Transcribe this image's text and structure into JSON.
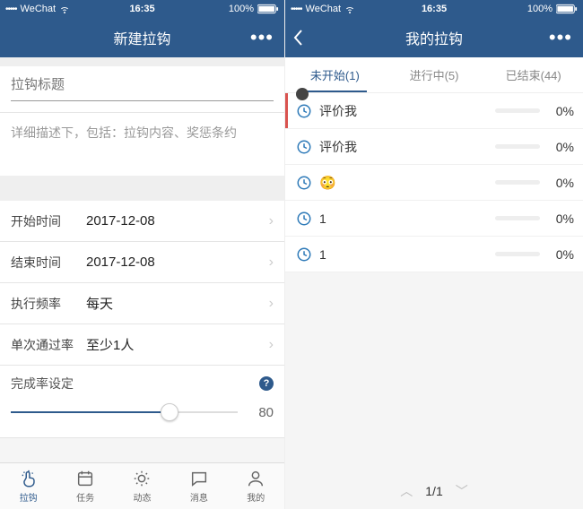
{
  "status": {
    "carrier": "WeChat",
    "signal": "•••••",
    "time": "16:35",
    "battery_pct": "100%"
  },
  "left": {
    "nav_title": "新建拉钩",
    "title_placeholder": "拉钩标题",
    "desc_placeholder": "详细描述下，包括：拉钩内容、奖惩条约",
    "rows": {
      "start_label": "开始时间",
      "start_value": "2017-12-08",
      "end_label": "结束时间",
      "end_value": "2017-12-08",
      "freq_label": "执行频率",
      "freq_value": "每天",
      "pass_label": "单次通过率",
      "pass_value": "至少1人"
    },
    "slider_label": "完成率设定",
    "slider_value": "80",
    "tabs": [
      "拉钩",
      "任务",
      "动态",
      "消息",
      "我的"
    ]
  },
  "right": {
    "nav_title": "我的拉钩",
    "tabs": [
      {
        "label": "未开始(1)",
        "active": true
      },
      {
        "label": "进行中(5)",
        "active": false
      },
      {
        "label": "已结束(44)",
        "active": false
      }
    ],
    "items": [
      {
        "label": "评价我",
        "pct": "0%"
      },
      {
        "label": "评价我",
        "pct": "0%"
      },
      {
        "label": "😳",
        "pct": "0%"
      },
      {
        "label": "1",
        "pct": "0%"
      },
      {
        "label": "1",
        "pct": "0%"
      }
    ],
    "pager": {
      "current": "1/1"
    }
  }
}
